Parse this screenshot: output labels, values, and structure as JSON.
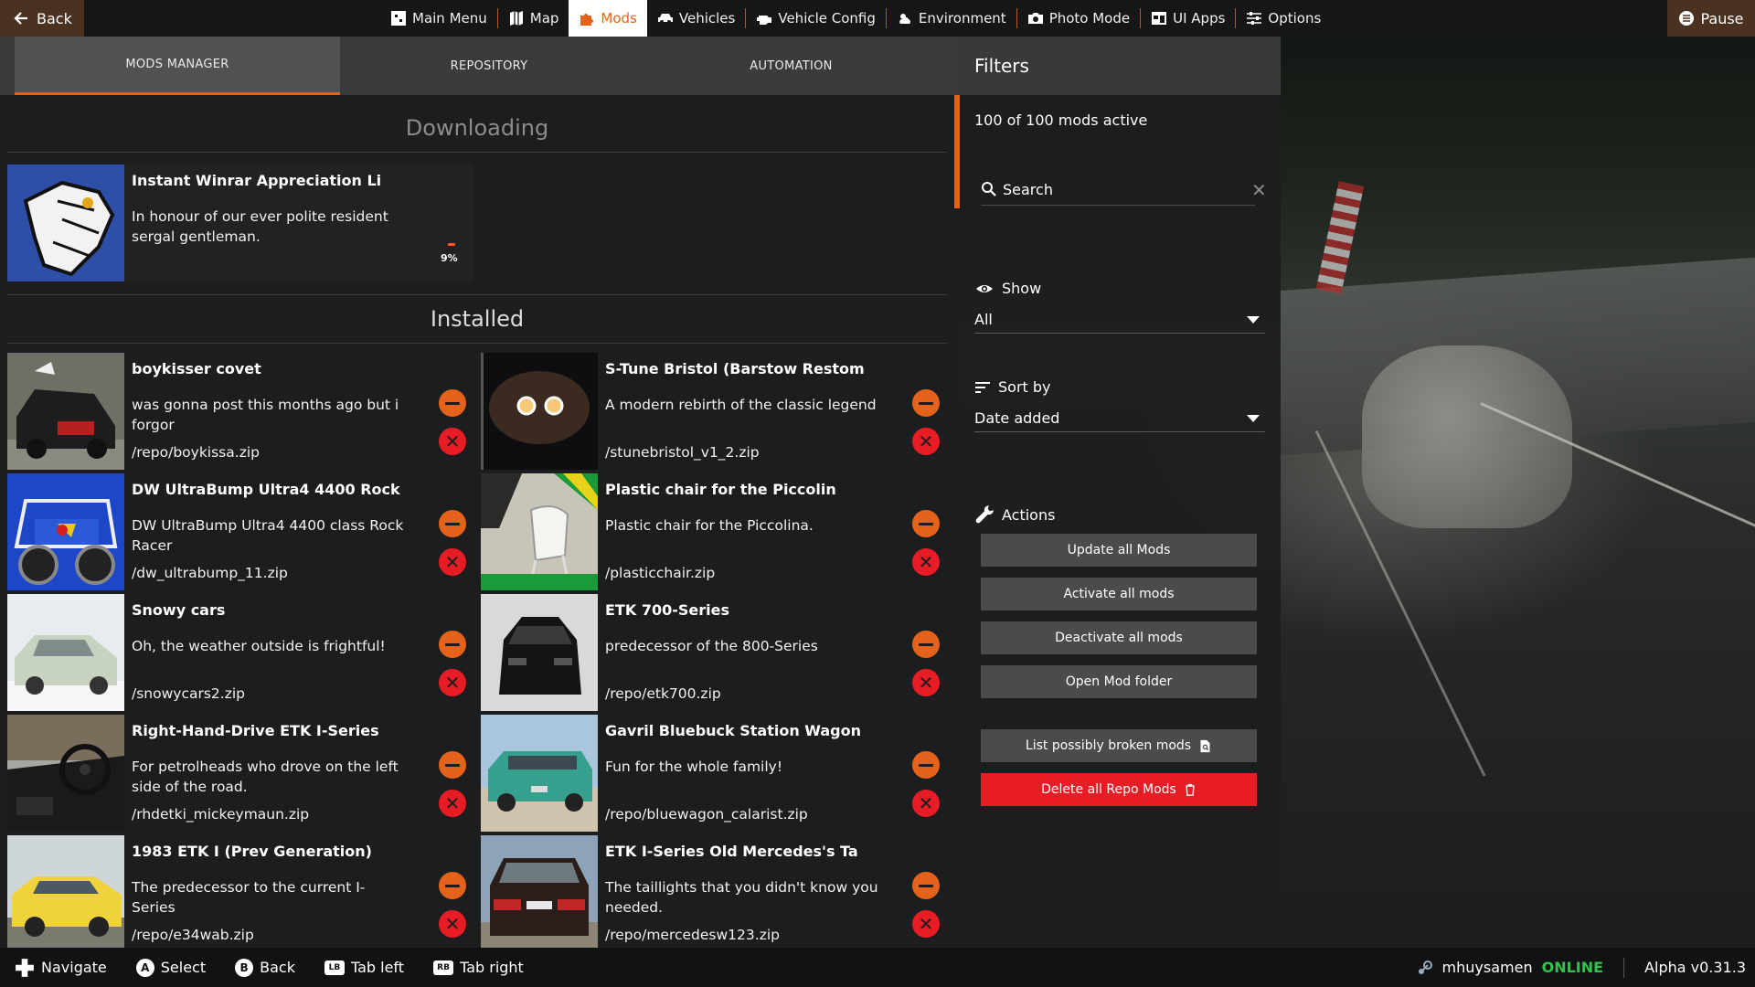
{
  "nav": {
    "back_label": "Back",
    "pause_label": "Pause",
    "items": [
      {
        "label": "Main Menu",
        "icon": "main-menu-icon"
      },
      {
        "label": "Map",
        "icon": "map-icon"
      },
      {
        "label": "Mods",
        "icon": "puzzle-icon",
        "active": true
      },
      {
        "label": "Vehicles",
        "icon": "car-icon"
      },
      {
        "label": "Vehicle Config",
        "icon": "engine-icon"
      },
      {
        "label": "Environment",
        "icon": "weather-icon"
      },
      {
        "label": "Photo Mode",
        "icon": "camera-icon"
      },
      {
        "label": "UI Apps",
        "icon": "ui-apps-icon"
      },
      {
        "label": "Options",
        "icon": "sliders-icon"
      }
    ]
  },
  "tabs": {
    "mods_manager": "MODS MANAGER",
    "repository": "REPOSITORY",
    "automation": "AUTOMATION"
  },
  "sections": {
    "downloading": "Downloading",
    "installed": "Installed"
  },
  "downloading": {
    "title": "Instant Winrar Appreciation Li",
    "desc": "In honour of our ever polite resident sergal gentleman.",
    "progress_label": "9%",
    "progress": 0.09
  },
  "mods": [
    {
      "title": "boykisser covet",
      "desc": "was gonna post this months ago but i forgor",
      "file": "/repo/boykissa.zip"
    },
    {
      "title": "S-Tune Bristol (Barstow Restom",
      "desc": "A modern rebirth of the classic legend",
      "file": "/stunebristol_v1_2.zip"
    },
    {
      "title": "DW UltraBump Ultra4 4400 Rock",
      "desc": "DW UltraBump Ultra4 4400 class Rock Racer",
      "file": "/dw_ultrabump_11.zip"
    },
    {
      "title": "Plastic chair for the Piccolin",
      "desc": "Plastic chair for the Piccolina.",
      "file": "/plasticchair.zip"
    },
    {
      "title": "Snowy cars",
      "desc": "Oh, the weather outside is frightful!",
      "file": "/snowycars2.zip"
    },
    {
      "title": "ETK 700-Series",
      "desc": "predecessor of the 800-Series",
      "file": "/repo/etk700.zip"
    },
    {
      "title": "Right-Hand-Drive ETK I-Series",
      "desc": "For petrolheads who drove on the left side of the road.",
      "file": "/rhdetki_mickeymaun.zip"
    },
    {
      "title": "Gavril Bluebuck Station Wagon",
      "desc": "Fun for the whole family!",
      "file": "/repo/bluewagon_calarist.zip"
    },
    {
      "title": "1983 ETK I (Prev Generation)",
      "desc": "The predecessor to the current I-Series",
      "file": "/repo/e34wab.zip"
    },
    {
      "title": "ETK I-Series Old Mercedes's Ta",
      "desc": "The taillights that you didn't know you needed.",
      "file": "/repo/mercedesw123.zip"
    }
  ],
  "filters": {
    "title": "Filters",
    "active_count": "100 of 100 mods active",
    "search_placeholder": "Search",
    "show_label": "Show",
    "show_value": "All",
    "sort_label": "Sort by",
    "sort_value": "Date added",
    "actions_label": "Actions",
    "actions": {
      "update_all": "Update all Mods",
      "activate_all": "Activate all mods",
      "deactivate_all": "Deactivate all mods",
      "open_folder": "Open Mod folder",
      "list_broken": "List possibly broken mods",
      "delete_repo": "Delete all Repo Mods"
    }
  },
  "bottom": {
    "hints": [
      {
        "glyph": "",
        "label": "Navigate",
        "icon": "dpad-icon"
      },
      {
        "glyph": "A",
        "label": "Select",
        "icon": "a-button-icon"
      },
      {
        "glyph": "B",
        "label": "Back",
        "icon": "b-button-icon"
      },
      {
        "glyph": "LB",
        "label": "Tab left",
        "icon": "lb-button-icon"
      },
      {
        "glyph": "RB",
        "label": "Tab right",
        "icon": "rb-button-icon"
      }
    ],
    "username": "mhuysamen",
    "status": "ONLINE",
    "version": "Alpha v0.31.3"
  },
  "colors": {
    "accent": "#e4621a",
    "danger": "#e81c24",
    "online": "#34c34a"
  }
}
